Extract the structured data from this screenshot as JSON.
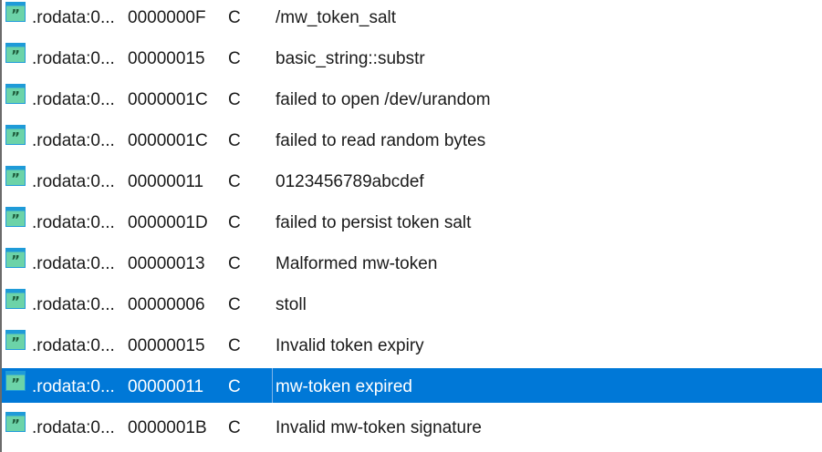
{
  "rows": [
    {
      "address": ".rodata:0...",
      "length": "0000000F",
      "type": "C",
      "string": "/mw_token_salt",
      "icon": "string-literal-icon",
      "selected": false
    },
    {
      "address": ".rodata:0...",
      "length": "00000015",
      "type": "C",
      "string": "basic_string::substr",
      "icon": "string-literal-icon",
      "selected": false
    },
    {
      "address": ".rodata:0...",
      "length": "0000001C",
      "type": "C",
      "string": "failed to open /dev/urandom",
      "icon": "string-literal-icon",
      "selected": false
    },
    {
      "address": ".rodata:0...",
      "length": "0000001C",
      "type": "C",
      "string": "failed to read random bytes",
      "icon": "string-literal-icon",
      "selected": false
    },
    {
      "address": ".rodata:0...",
      "length": "00000011",
      "type": "C",
      "string": "0123456789abcdef",
      "icon": "string-literal-icon",
      "selected": false
    },
    {
      "address": ".rodata:0...",
      "length": "0000001D",
      "type": "C",
      "string": "failed to persist token salt",
      "icon": "string-literal-icon",
      "selected": false
    },
    {
      "address": ".rodata:0...",
      "length": "00000013",
      "type": "C",
      "string": "Malformed mw-token",
      "icon": "string-literal-icon",
      "selected": false
    },
    {
      "address": ".rodata:0...",
      "length": "00000006",
      "type": "C",
      "string": "stoll",
      "icon": "string-literal-icon",
      "selected": false
    },
    {
      "address": ".rodata:0...",
      "length": "00000015",
      "type": "C",
      "string": "Invalid token expiry",
      "icon": "string-literal-icon",
      "selected": false
    },
    {
      "address": ".rodata:0...",
      "length": "00000011",
      "type": "C",
      "string": "mw-token expired",
      "icon": "string-literal-icon",
      "selected": true
    },
    {
      "address": ".rodata:0...",
      "length": "0000001B",
      "type": "C",
      "string": "Invalid mw-token signature",
      "icon": "string-literal-icon",
      "selected": false
    }
  ],
  "colors": {
    "selection": "#0078d7",
    "icon_frame": "#1f9bd8",
    "icon_fill": "#6cd3a8",
    "icon_quote": "#1e5a3a"
  }
}
